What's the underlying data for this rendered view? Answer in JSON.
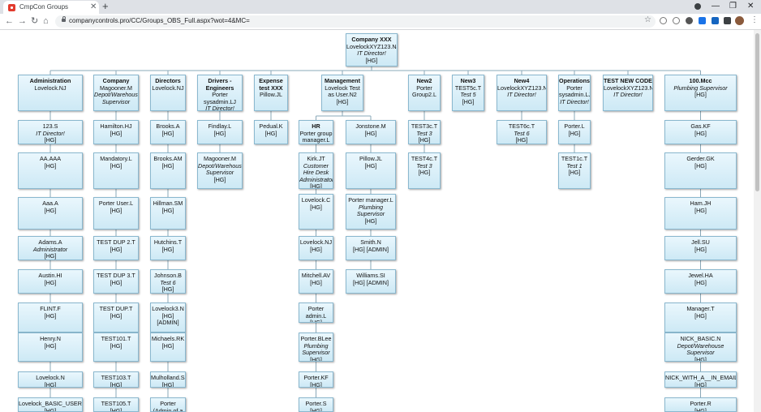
{
  "browser": {
    "tab_title": "CmpCon Groups",
    "url": "companycontrols.pro/CC/Groups_OBS_Full.aspx?wot=4&MC="
  },
  "chart": {
    "root": {
      "name": "Company XXX",
      "lines": [
        "LovelockXYZ123.NJ"
      ],
      "title": "IT Director!",
      "group": "[HG]"
    },
    "columns": [
      {
        "header": {
          "name": "Administration",
          "lines": [
            "Lovelock.NJ"
          ],
          "title": "",
          "group": ""
        },
        "members": [
          {
            "name": "123.S",
            "title": "IT Director!",
            "group": "[HG]"
          },
          {
            "name": "AA.AAA",
            "title": "",
            "group": "[HG]"
          },
          {
            "name": "Aaa.A",
            "title": "",
            "group": "[HG]"
          },
          {
            "name": "Adams.A",
            "title": "Administrator",
            "group": "[HG]"
          },
          {
            "name": "Austin.HI",
            "title": "",
            "group": "[HG]"
          },
          {
            "name": "FLINT.F",
            "title": "",
            "group": "[HG]"
          },
          {
            "name": "Henry.N",
            "title": "",
            "group": "[HG]"
          },
          {
            "name": "Lovelock.N",
            "title": "",
            "group": "[HG]"
          },
          {
            "name": "Lovelock_BASIC_USER.N",
            "title": "",
            "group": "[HG]"
          }
        ]
      },
      {
        "header": {
          "name": "Company",
          "lines": [
            "Magooner.M"
          ],
          "title": "Depot/Warehouse Supervisor",
          "group": ""
        },
        "members": [
          {
            "name": "Hamilton.HJ",
            "title": "",
            "group": "[HG]"
          },
          {
            "name": "Mandatory.L",
            "title": "",
            "group": "[HG]"
          },
          {
            "name": "Porter User.L",
            "title": "",
            "group": "[HG]"
          },
          {
            "name": "TEST DUP 2.T",
            "title": "",
            "group": "[HG]"
          },
          {
            "name": "TEST DUP 3.T",
            "title": "",
            "group": "[HG]"
          },
          {
            "name": "TEST DUP.T",
            "title": "",
            "group": "[HG]"
          },
          {
            "name": "TEST101.T",
            "title": "",
            "group": "[HG]"
          },
          {
            "name": "TEST103.T",
            "title": "",
            "group": "[HG]"
          },
          {
            "name": "TEST105.T",
            "title": "",
            "group": "[HG]"
          }
        ]
      },
      {
        "header": {
          "name": "Directors",
          "lines": [
            "Lovelock.NJ"
          ],
          "title": "",
          "group": ""
        },
        "members": [
          {
            "name": "Brooks.A",
            "title": "",
            "group": "[HG]"
          },
          {
            "name": "Brooks.AM",
            "title": "",
            "group": "[HG]"
          },
          {
            "name": "Hillman.SM",
            "title": "",
            "group": "[HG]"
          },
          {
            "name": "Hutchins.T",
            "title": "",
            "group": "[HG]"
          },
          {
            "name": "Johnson.B",
            "title": "Test 6",
            "group": "[HG]"
          },
          {
            "name": "Lovelock3.N",
            "title": "",
            "group": "[HG] [ADMIN]"
          },
          {
            "name": "Michaels.RK",
            "title": "",
            "group": "[HG]"
          },
          {
            "name": "Mulholland.SJ",
            "title": "",
            "group": "[HG]"
          },
          {
            "name": "Porter (Admin of a group",
            "title": "",
            "group": "[HG]"
          }
        ]
      },
      {
        "header": {
          "name": "Drivers - Engineers",
          "lines": [
            "Porter sysadmin.LJ"
          ],
          "title": "IT Director!",
          "group": ""
        },
        "members": [
          {
            "name": "Findlay.L",
            "title": "",
            "group": "[HG]"
          },
          {
            "name": "Magooner.M",
            "title": "Depot/Warehouse Supervisor",
            "group": "[HG]"
          }
        ]
      },
      {
        "header": {
          "name": "Expense test XXX",
          "lines": [
            "Pillow.JL"
          ],
          "title": "",
          "group": ""
        },
        "members": [
          {
            "name": "Pedual.K",
            "title": "",
            "group": "[HG]"
          }
        ]
      },
      {
        "header": {
          "name": "Management",
          "lines": [
            "Lovelock Test as User.N2"
          ],
          "title": "",
          "group": "[HG]"
        },
        "members": []
      },
      {
        "header": {
          "name": "New2",
          "lines": [
            "Porter Group2.L"
          ],
          "title": "",
          "group": ""
        },
        "members": [
          {
            "name": "TEST3c.T",
            "title": "Test 3",
            "group": "[HG]"
          },
          {
            "name": "TEST4c.T",
            "title": "Test 3",
            "group": "[HG]"
          }
        ]
      },
      {
        "header": {
          "name": "New3",
          "lines": [
            "TEST5c.T"
          ],
          "title": "Test 5",
          "group": "[HG]"
        },
        "members": []
      },
      {
        "header": {
          "name": "New4",
          "lines": [
            "LovelockXYZ123.NJ"
          ],
          "title": "IT Director!",
          "group": ""
        },
        "members": [
          {
            "name": "TEST6c.T",
            "title": "Test 6",
            "group": "[HG]"
          }
        ]
      },
      {
        "header": {
          "name": "Operations",
          "lines": [
            "Porter sysadmin.LJ"
          ],
          "title": "IT Director!",
          "group": ""
        },
        "members": [
          {
            "name": "Porter.L",
            "title": "",
            "group": "[HG]"
          },
          {
            "name": "TEST1c.T",
            "title": "Test 1",
            "group": "[HG]"
          }
        ]
      },
      {
        "header": {
          "name": "TEST NEW CODE",
          "lines": [
            "LovelockXYZ123.NJ"
          ],
          "title": "IT Director!",
          "group": ""
        },
        "members": []
      },
      {
        "header": {
          "name": "100.Mcc",
          "lines": [],
          "title": "Plumbing Supervisor",
          "group": "[HG]"
        },
        "members": [
          {
            "name": "Gas.KF",
            "title": "",
            "group": "[HG]"
          },
          {
            "name": "Gerder.GK",
            "title": "",
            "group": "[HG]"
          },
          {
            "name": "Ham.JH",
            "title": "",
            "group": "[HG]"
          },
          {
            "name": "Jell.SU",
            "title": "",
            "group": "[HG]"
          },
          {
            "name": "Jewel.HA",
            "title": "",
            "group": "[HG]"
          },
          {
            "name": "Manager.T",
            "title": "",
            "group": "[HG]"
          },
          {
            "name": "NICK_BASIC.N",
            "title": "Depot/Warehouse Supervisor",
            "group": "[HG]"
          },
          {
            "name": "NICK_WITH_A__IN_EMAIL.N",
            "title": "",
            "group": "[HG]"
          },
          {
            "name": "Porter.R",
            "title": "",
            "group": "[HG]"
          }
        ]
      }
    ],
    "management_subgroups": [
      {
        "header": {
          "name": "HR",
          "lines": [
            "Porter group manager.L"
          ],
          "title": "",
          "group": ""
        },
        "members": [
          {
            "name": "Kirk.JT",
            "title": "Customer Hire Desk Administrator",
            "group": "[HG]"
          },
          {
            "name": "Lovelock.C",
            "title": "",
            "group": "[HG]"
          },
          {
            "name": "Lovelock.NJ",
            "title": "",
            "group": "[HG]"
          },
          {
            "name": "Mitchell.AV",
            "title": "",
            "group": "[HG]"
          },
          {
            "name": "Porter admin.L",
            "title": "",
            "group": "[HG]"
          },
          {
            "name": "Porter.BLee",
            "title": "Plumbing Supervisor",
            "group": "[HG]"
          },
          {
            "name": "Porter.KF",
            "title": "",
            "group": "[HG]"
          },
          {
            "name": "Porter.S",
            "title": "",
            "group": "[HG]"
          }
        ]
      },
      {
        "header": {
          "name": "Jonstone.M",
          "lines": [],
          "title": "",
          "group": "[HG]"
        },
        "members": [
          {
            "name": "Pillow.JL",
            "title": "",
            "group": "[HG]"
          },
          {
            "name": "Porter manager.L",
            "title": "Plumbing Supervisor",
            "group": "[HG]"
          },
          {
            "name": "Smith.N",
            "title": "",
            "group": "[HG] [ADMIN]"
          },
          {
            "name": "Williams.SI",
            "title": "",
            "group": "[HG] [ADMIN]"
          }
        ]
      }
    ]
  }
}
